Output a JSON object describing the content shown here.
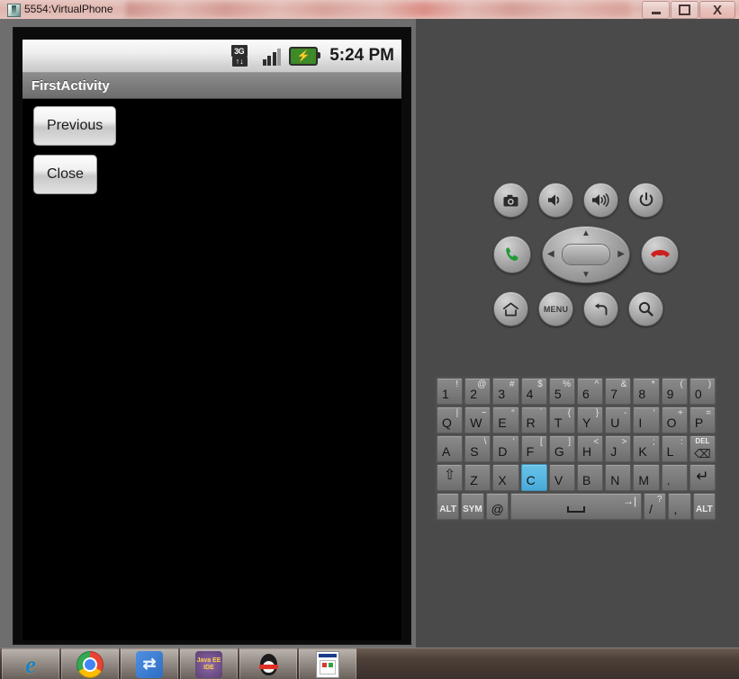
{
  "window": {
    "title": "5554:VirtualPhone",
    "icon": "emulator-icon",
    "controls": {
      "minimize": "—",
      "maximize": "□",
      "close": "X"
    }
  },
  "android": {
    "status_bar": {
      "network_label": "3G",
      "network_arrows": "↑↓",
      "battery_glyph": "⚡",
      "time": "5:24 PM",
      "signal_bars": 3,
      "signal_total": 4
    },
    "app": {
      "title": "FirstActivity",
      "buttons": [
        {
          "label": "Previous",
          "name": "previous-button"
        },
        {
          "label": "Close",
          "name": "close-button"
        }
      ]
    }
  },
  "hardware": {
    "row1": [
      {
        "name": "camera-button",
        "icon": "camera-icon"
      },
      {
        "name": "volume-down-button",
        "icon": "volume-down-icon"
      },
      {
        "name": "volume-up-button",
        "icon": "volume-up-icon"
      },
      {
        "name": "power-button",
        "icon": "power-icon"
      }
    ],
    "row2": [
      {
        "name": "call-button",
        "icon": "phone-green-icon"
      },
      {
        "name": "dpad",
        "icon": "dpad-icon"
      },
      {
        "name": "end-call-button",
        "icon": "phone-red-icon"
      }
    ],
    "row3": [
      {
        "name": "home-button",
        "icon": "home-icon",
        "label": ""
      },
      {
        "name": "menu-button",
        "icon": "menu-icon",
        "label": "MENU"
      },
      {
        "name": "back-button",
        "icon": "back-arrow-icon",
        "label": ""
      },
      {
        "name": "search-button",
        "icon": "search-icon",
        "label": ""
      }
    ],
    "dpad_arrows": {
      "up": "▲",
      "down": "▼",
      "left": "◀",
      "right": "▶"
    }
  },
  "keyboard": {
    "rows": [
      [
        {
          "main": "1",
          "alt": "!"
        },
        {
          "main": "2",
          "alt": "@"
        },
        {
          "main": "3",
          "alt": "#"
        },
        {
          "main": "4",
          "alt": "$"
        },
        {
          "main": "5",
          "alt": "%"
        },
        {
          "main": "6",
          "alt": "^"
        },
        {
          "main": "7",
          "alt": "&"
        },
        {
          "main": "8",
          "alt": "*"
        },
        {
          "main": "9",
          "alt": "("
        },
        {
          "main": "0",
          "alt": ")"
        }
      ],
      [
        {
          "main": "Q",
          "alt": "|"
        },
        {
          "main": "W",
          "alt": "~"
        },
        {
          "main": "E",
          "alt": "“"
        },
        {
          "main": "R",
          "alt": "`"
        },
        {
          "main": "T",
          "alt": "{"
        },
        {
          "main": "Y",
          "alt": "}"
        },
        {
          "main": "U",
          "alt": "-"
        },
        {
          "main": "I",
          "alt": "'"
        },
        {
          "main": "O",
          "alt": "+"
        },
        {
          "main": "P",
          "alt": "="
        }
      ],
      [
        {
          "main": "A",
          "alt": ""
        },
        {
          "main": "S",
          "alt": "\\"
        },
        {
          "main": "D",
          "alt": "'"
        },
        {
          "main": "F",
          "alt": "["
        },
        {
          "main": "G",
          "alt": "]"
        },
        {
          "main": "H",
          "alt": "<"
        },
        {
          "main": "J",
          "alt": ">"
        },
        {
          "main": "K",
          "alt": ";"
        },
        {
          "main": "L",
          "alt": ":"
        },
        {
          "main": "DEL",
          "alt": "",
          "type": "del",
          "sub": "⌫"
        }
      ],
      [
        {
          "main": "⇧",
          "alt": "",
          "type": "shift"
        },
        {
          "main": "Z",
          "alt": ""
        },
        {
          "main": "X",
          "alt": ""
        },
        {
          "main": "C",
          "alt": "",
          "active": true
        },
        {
          "main": "V",
          "alt": ""
        },
        {
          "main": "B",
          "alt": ""
        },
        {
          "main": "N",
          "alt": ""
        },
        {
          "main": "M",
          "alt": ""
        },
        {
          "main": ".",
          "alt": ""
        },
        {
          "main": "↵",
          "alt": "",
          "type": "enter"
        }
      ],
      [
        {
          "main": "ALT",
          "alt": "",
          "type": "label"
        },
        {
          "main": "SYM",
          "alt": "",
          "type": "label"
        },
        {
          "main": "@",
          "alt": ""
        },
        {
          "main": "",
          "alt": "→|",
          "type": "space"
        },
        {
          "main": "/",
          "alt": "?"
        },
        {
          "main": ",",
          "alt": ""
        },
        {
          "main": "ALT",
          "alt": "",
          "type": "label"
        }
      ]
    ],
    "active_key": "C"
  },
  "taskbar": {
    "items": [
      {
        "name": "taskbar-internet-explorer",
        "icon": "internet-explorer-icon",
        "glyph": "e"
      },
      {
        "name": "taskbar-chrome",
        "icon": "chrome-icon",
        "glyph": ""
      },
      {
        "name": "taskbar-blue-app",
        "icon": "blue-app-icon",
        "glyph": "⇄"
      },
      {
        "name": "taskbar-java-ee-ide",
        "icon": "eclipse-java-ee-icon",
        "line1": "Java EE",
        "line2": "IDE"
      },
      {
        "name": "taskbar-qq",
        "icon": "qq-penguin-icon",
        "glyph": ""
      },
      {
        "name": "taskbar-document",
        "icon": "document-icon",
        "glyph": ""
      }
    ]
  },
  "colors": {
    "accent_key": "#55b5e0",
    "title_bar": "#dfb5ae",
    "emulator_left": "#6e6e6e",
    "emulator_right": "#4a4a4a",
    "screen": "#000000"
  }
}
